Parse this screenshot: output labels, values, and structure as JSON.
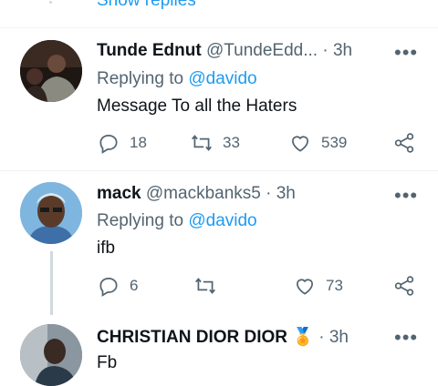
{
  "top": {
    "show_replies": "Show replies"
  },
  "tweets": [
    {
      "name": "Tunde Ednut",
      "handle": "@TundeEdd...",
      "dot": "·",
      "time": "3h",
      "reply_prefix": "Replying to",
      "reply_to": "@davido",
      "text": "Message To all the Haters",
      "replies": "18",
      "retweets": "33",
      "likes": "539"
    },
    {
      "name": "mack",
      "handle": "@mackbanks5",
      "dot": "·",
      "time": "3h",
      "reply_prefix": "Replying to",
      "reply_to": "@davido",
      "text": "ifb",
      "replies": "6",
      "retweets": "",
      "likes": "73"
    },
    {
      "name": "CHRISTIAN DIOR DIOR",
      "name_badge": "🏅",
      "handle": "",
      "dot": "·",
      "time": "3h",
      "text": "Fb"
    }
  ],
  "more_label": "•••",
  "colors": {
    "accent": "#1d9bf0",
    "secondary": "#536471",
    "text": "#0f1419"
  },
  "icons": [
    "reply-icon",
    "retweet-icon",
    "like-icon",
    "share-icon",
    "more-icon",
    "medal-icon"
  ]
}
